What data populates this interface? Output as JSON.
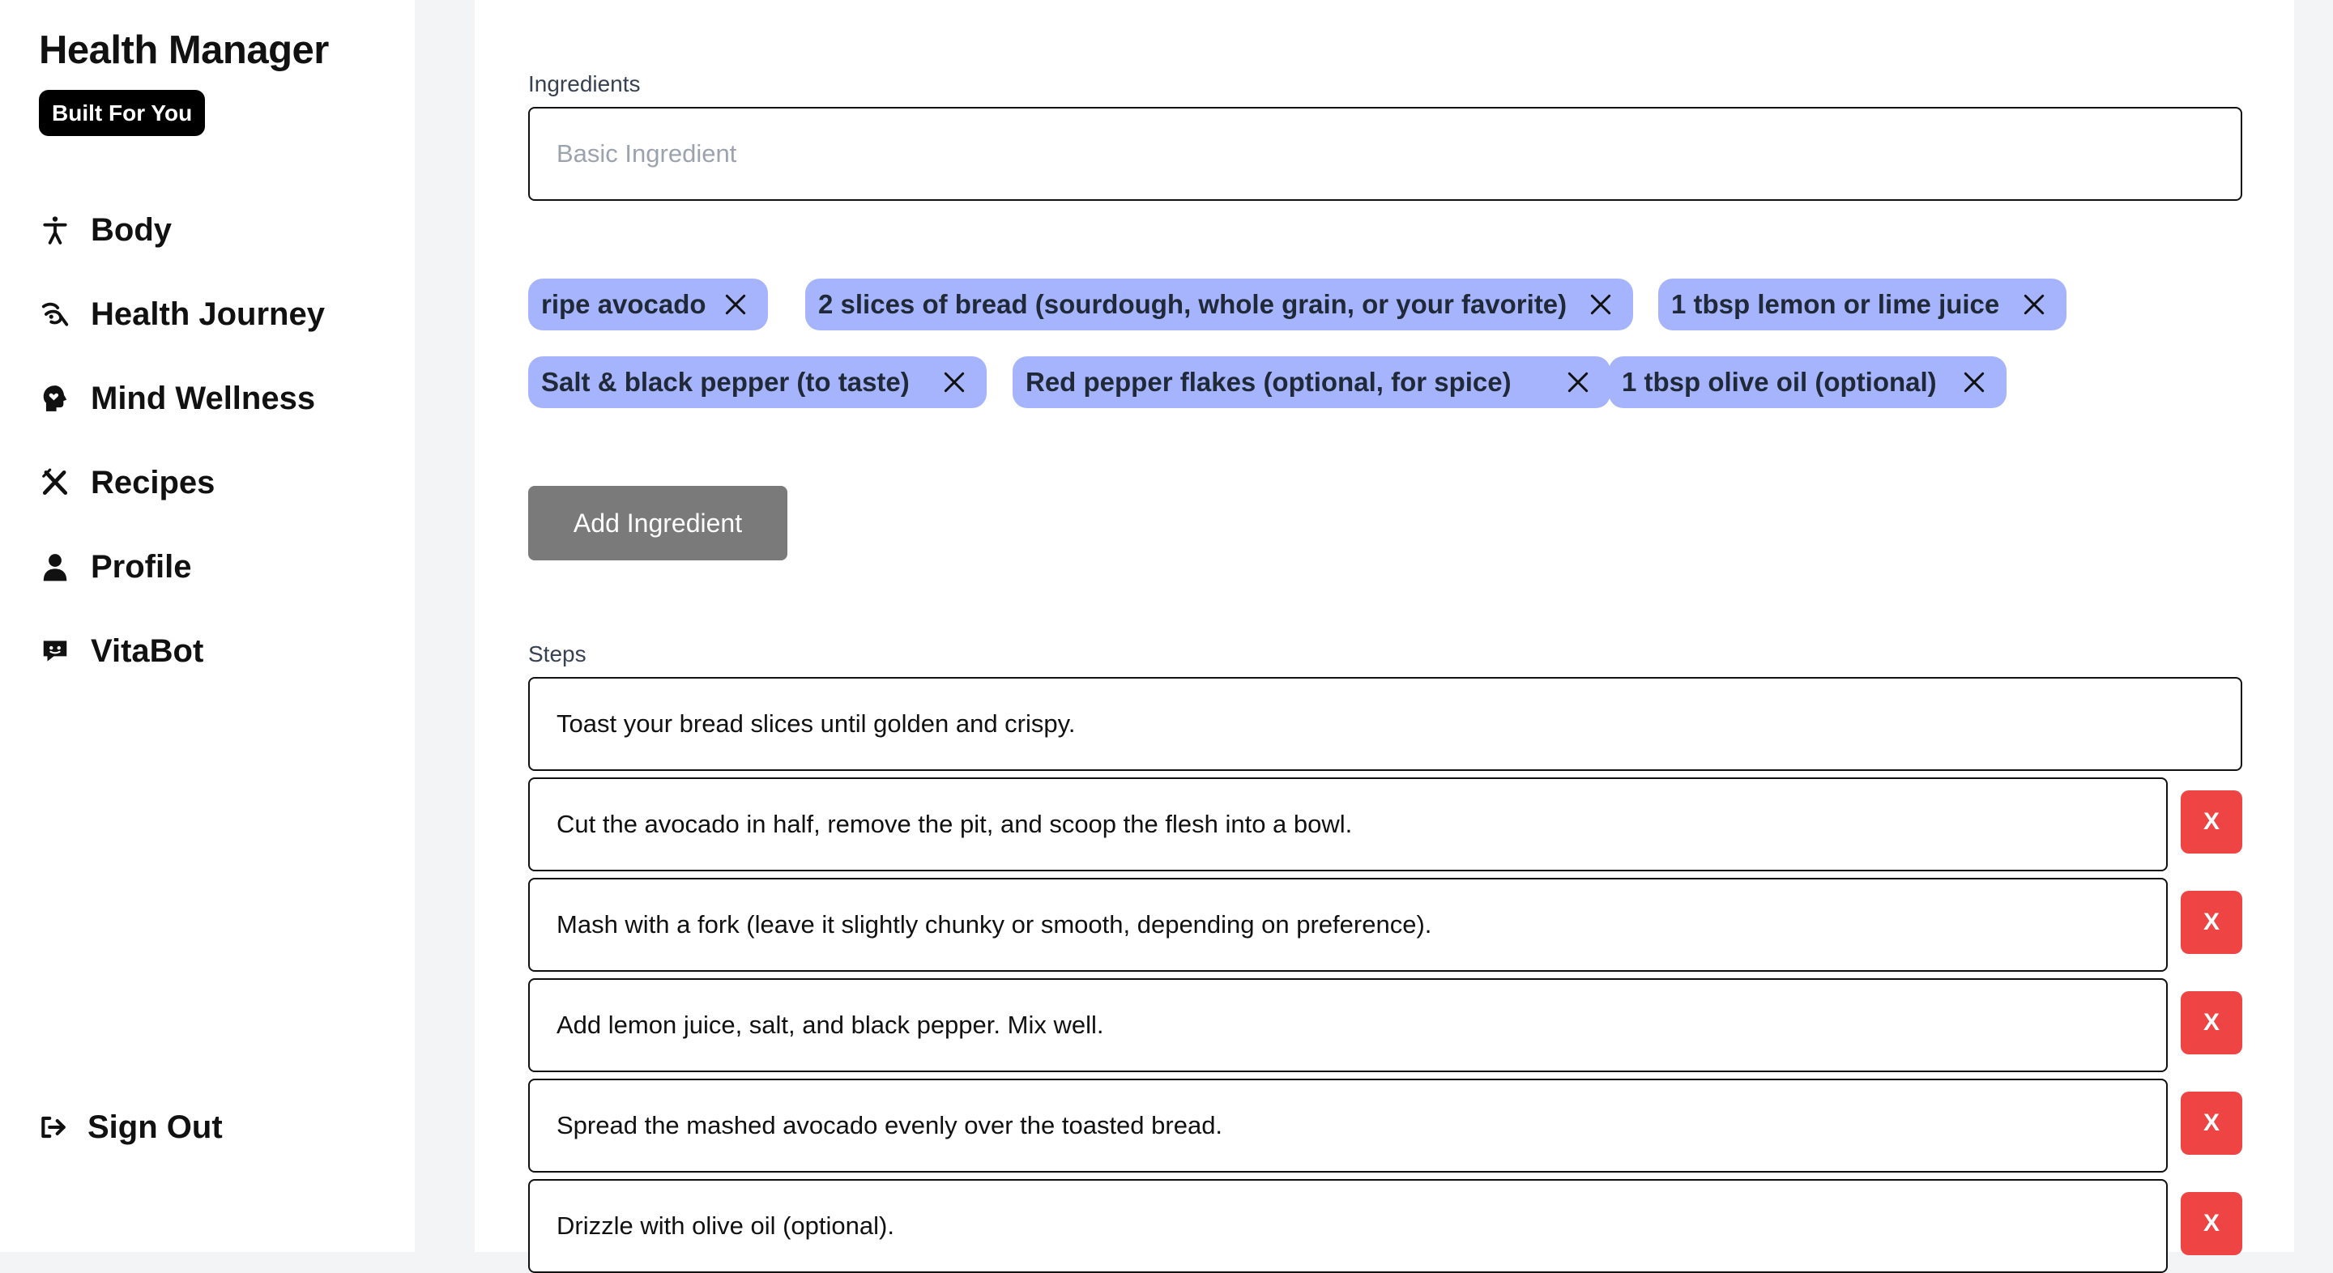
{
  "sidebar": {
    "app_title": "Health Manager",
    "tagline": "Built For You",
    "nav": [
      {
        "label": "Body",
        "icon": "accessibility-icon"
      },
      {
        "label": "Health Journey",
        "icon": "journey-icon"
      },
      {
        "label": "Mind Wellness",
        "icon": "head-heart-icon"
      },
      {
        "label": "Recipes",
        "icon": "utensils-icon"
      },
      {
        "label": "Profile",
        "icon": "user-icon"
      },
      {
        "label": "VitaBot",
        "icon": "chat-bot-icon"
      }
    ],
    "sign_out": {
      "label": "Sign Out",
      "icon": "sign-out-icon"
    }
  },
  "form": {
    "ingredients_label": "Ingredients",
    "ingredient_input": {
      "value": "",
      "placeholder": "Basic Ingredient"
    },
    "ingredients": [
      "ripe avocado",
      "2 slices of bread (sourdough, whole grain, or your favorite)",
      "1 tbsp lemon or lime juice",
      "Salt & black pepper (to taste)",
      "Red pepper flakes (optional, for spice)",
      "1 tbsp olive oil (optional)"
    ],
    "add_ingredient_label": "Add Ingredient",
    "steps_label": "Steps",
    "steps": [
      "Toast your bread slices until golden and crispy.",
      "Cut the avocado in half, remove the pit, and scoop the flesh into a bowl.",
      "Mash with a fork (leave it slightly chunky or smooth, depending on preference).",
      "Add lemon juice, salt, and black pepper. Mix well.",
      "Spread the mashed avocado evenly over the toasted bread.",
      "Drizzle with olive oil (optional)."
    ],
    "delete_step_label": "X"
  },
  "colors": {
    "chip_background": "#a5b4fc",
    "delete_button": "#ef4444",
    "add_button": "#7a7a7a",
    "tagline_background": "#000000",
    "page_background": "#f3f4f6"
  }
}
